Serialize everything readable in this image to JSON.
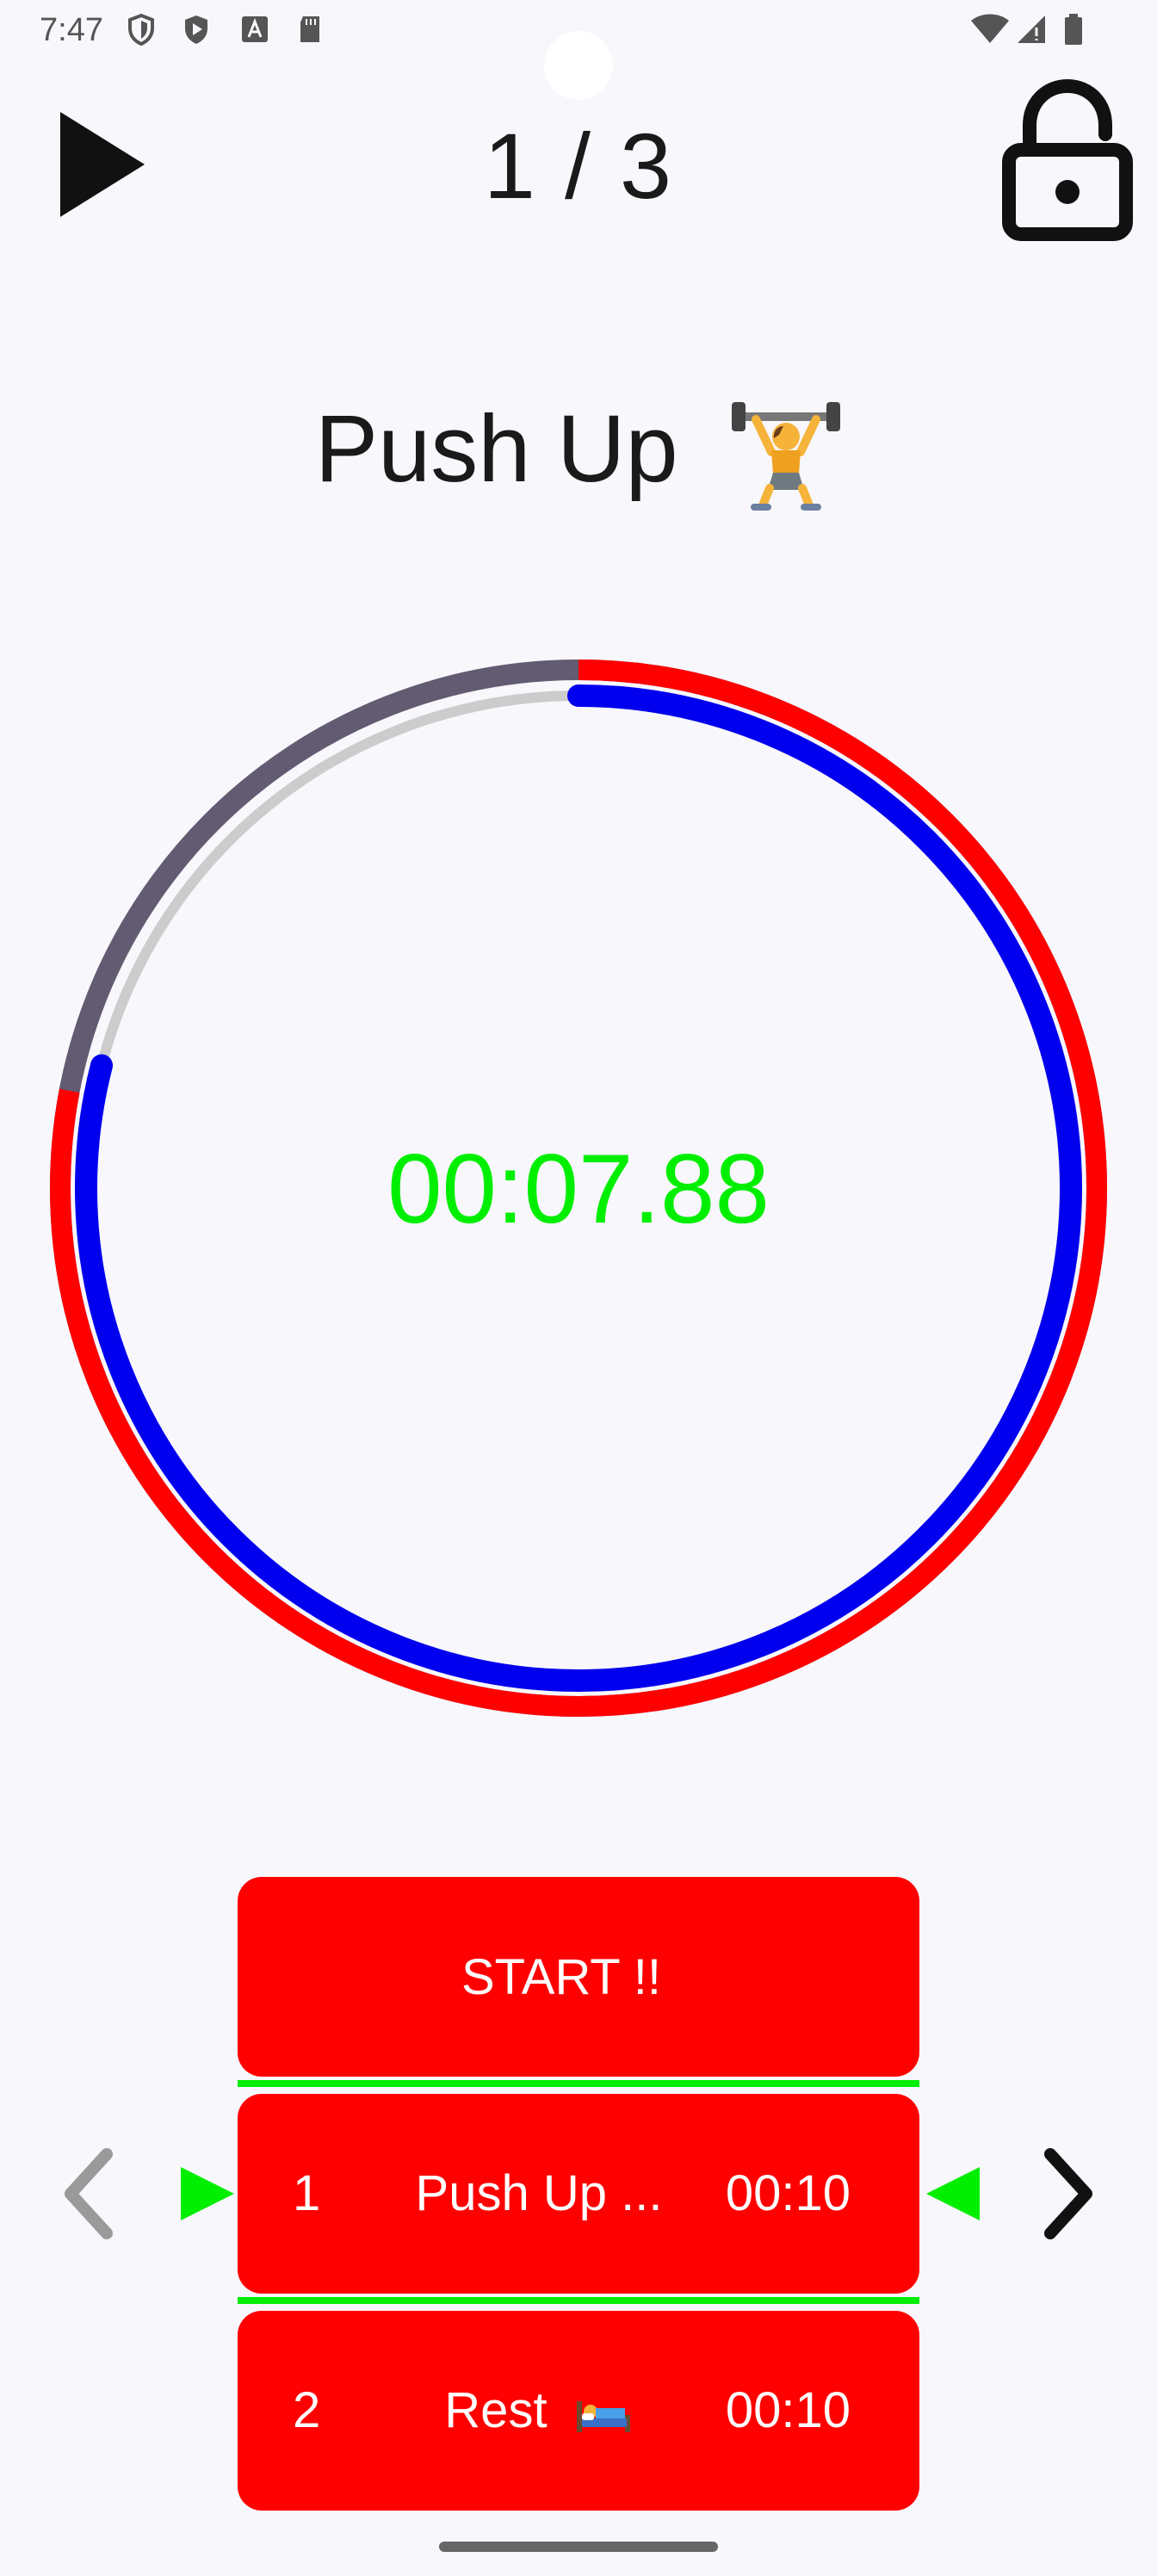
{
  "status_bar": {
    "time": "7:47",
    "left_icons": [
      "shield-icon",
      "play-store-icon",
      "font-icon",
      "sd-card-icon"
    ],
    "right_icons": [
      "wifi-icon",
      "signal-icon",
      "battery-icon"
    ]
  },
  "header": {
    "counter": "1 / 3",
    "play_icon": "play-icon",
    "lock_icon": "unlock-icon"
  },
  "exercise": {
    "title": "Push Up",
    "emoji": "weightlifter-emoji"
  },
  "timer": {
    "time": "00:07.88",
    "progress_outer_fraction": 0.78,
    "progress_inner_fraction": 0.79,
    "colors": {
      "outer": "#ff0000",
      "outer_remaining": "#625b71",
      "inner": "#0000ee",
      "inner_track": "#cccccc",
      "time_text": "#00ee00"
    }
  },
  "list": {
    "start_label": "START !!",
    "items": [
      {
        "num": "1",
        "name": "Push Up ...",
        "time": "00:10"
      },
      {
        "num": "2",
        "name": "Rest",
        "emoji": "bed-emoji",
        "time": "00:10"
      }
    ],
    "card_color": "#ff0000",
    "marker_color": "#00ee00"
  },
  "nav": {
    "prev_icon": "chevron-left-icon",
    "next_icon": "chevron-right-icon"
  }
}
